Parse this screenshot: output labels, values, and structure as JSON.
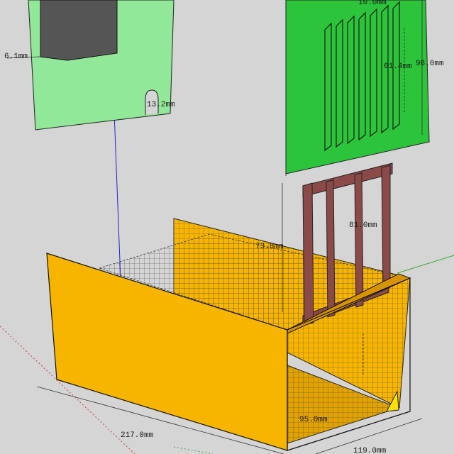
{
  "dimensions": {
    "top_left_width": "6.1mm",
    "notch_size": "13.2mm",
    "slot_spacing": "10.0mm",
    "slot_length": "61.4mm",
    "panel_height": "98.0mm",
    "wall_height": "73.8mm",
    "frame_height": "81.0mm",
    "inner_depth": "95.0mm",
    "box_length": "217.0mm",
    "box_width": "119.0mm"
  },
  "colors": {
    "background": "#d5d5d5",
    "box_face": "#f8b500",
    "box_face_dark": "#d89400",
    "floor": "#e2a300",
    "panel_light": "#90e898",
    "panel_dark": "#2cc43a",
    "frame": "#8b4a48",
    "axis_blue": "#2222cc",
    "axis_green": "#33aa33",
    "axis_red": "#cc4444"
  }
}
